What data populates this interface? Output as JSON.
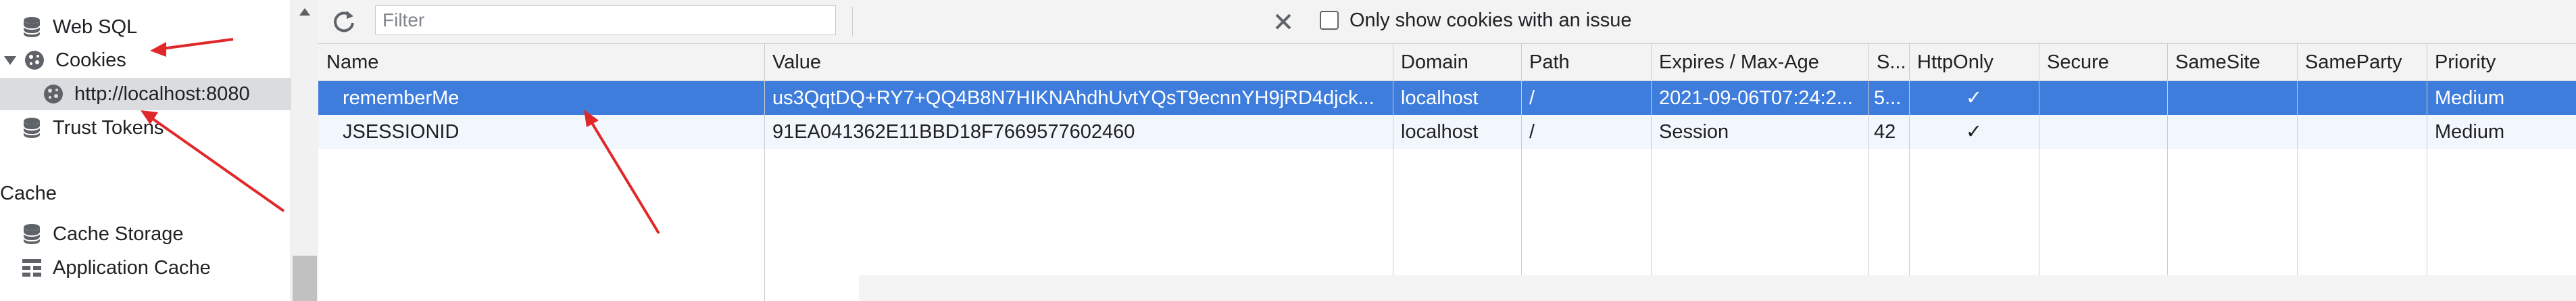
{
  "sidebar": {
    "items": [
      {
        "label": "Web SQL",
        "icon": "database-icon"
      },
      {
        "label": "Cookies",
        "icon": "cookie-icon"
      },
      {
        "label": "http://localhost:8080",
        "icon": "cookie-icon"
      },
      {
        "label": "Trust Tokens",
        "icon": "database-icon"
      }
    ],
    "cache_section": {
      "title": "Cache",
      "items": [
        {
          "label": "Cache Storage",
          "icon": "database-icon"
        },
        {
          "label": "Application Cache",
          "icon": "grid-icon"
        }
      ]
    }
  },
  "toolbar": {
    "filter_placeholder": "Filter",
    "issue_checkbox_label": "Only show cookies with an issue",
    "issue_checkbox_checked": false
  },
  "table": {
    "columns": [
      "Name",
      "Value",
      "Domain",
      "Path",
      "Expires / Max-Age",
      "S...",
      "HttpOnly",
      "Secure",
      "SameSite",
      "SameParty",
      "Priority"
    ],
    "rows": [
      {
        "selected": true,
        "cells": [
          "rememberMe",
          "us3QqtDQ+RY7+QQ4B8N7HIKNAhdhUvtYQsT9ecnnYH9jRD4djck...",
          "localhost",
          "/",
          "2021-09-06T07:24:2...",
          "5...",
          "✓",
          "",
          "",
          "",
          "Medium"
        ]
      },
      {
        "selected": false,
        "cells": [
          "JSESSIONID",
          "91EA041362E11BBD18F7669577602460",
          "localhost",
          "/",
          "Session",
          "42",
          "✓",
          "",
          "",
          "",
          "Medium"
        ]
      }
    ]
  },
  "colors": {
    "selected_row": "#3f7ddc",
    "annotation": "#e0282a"
  }
}
